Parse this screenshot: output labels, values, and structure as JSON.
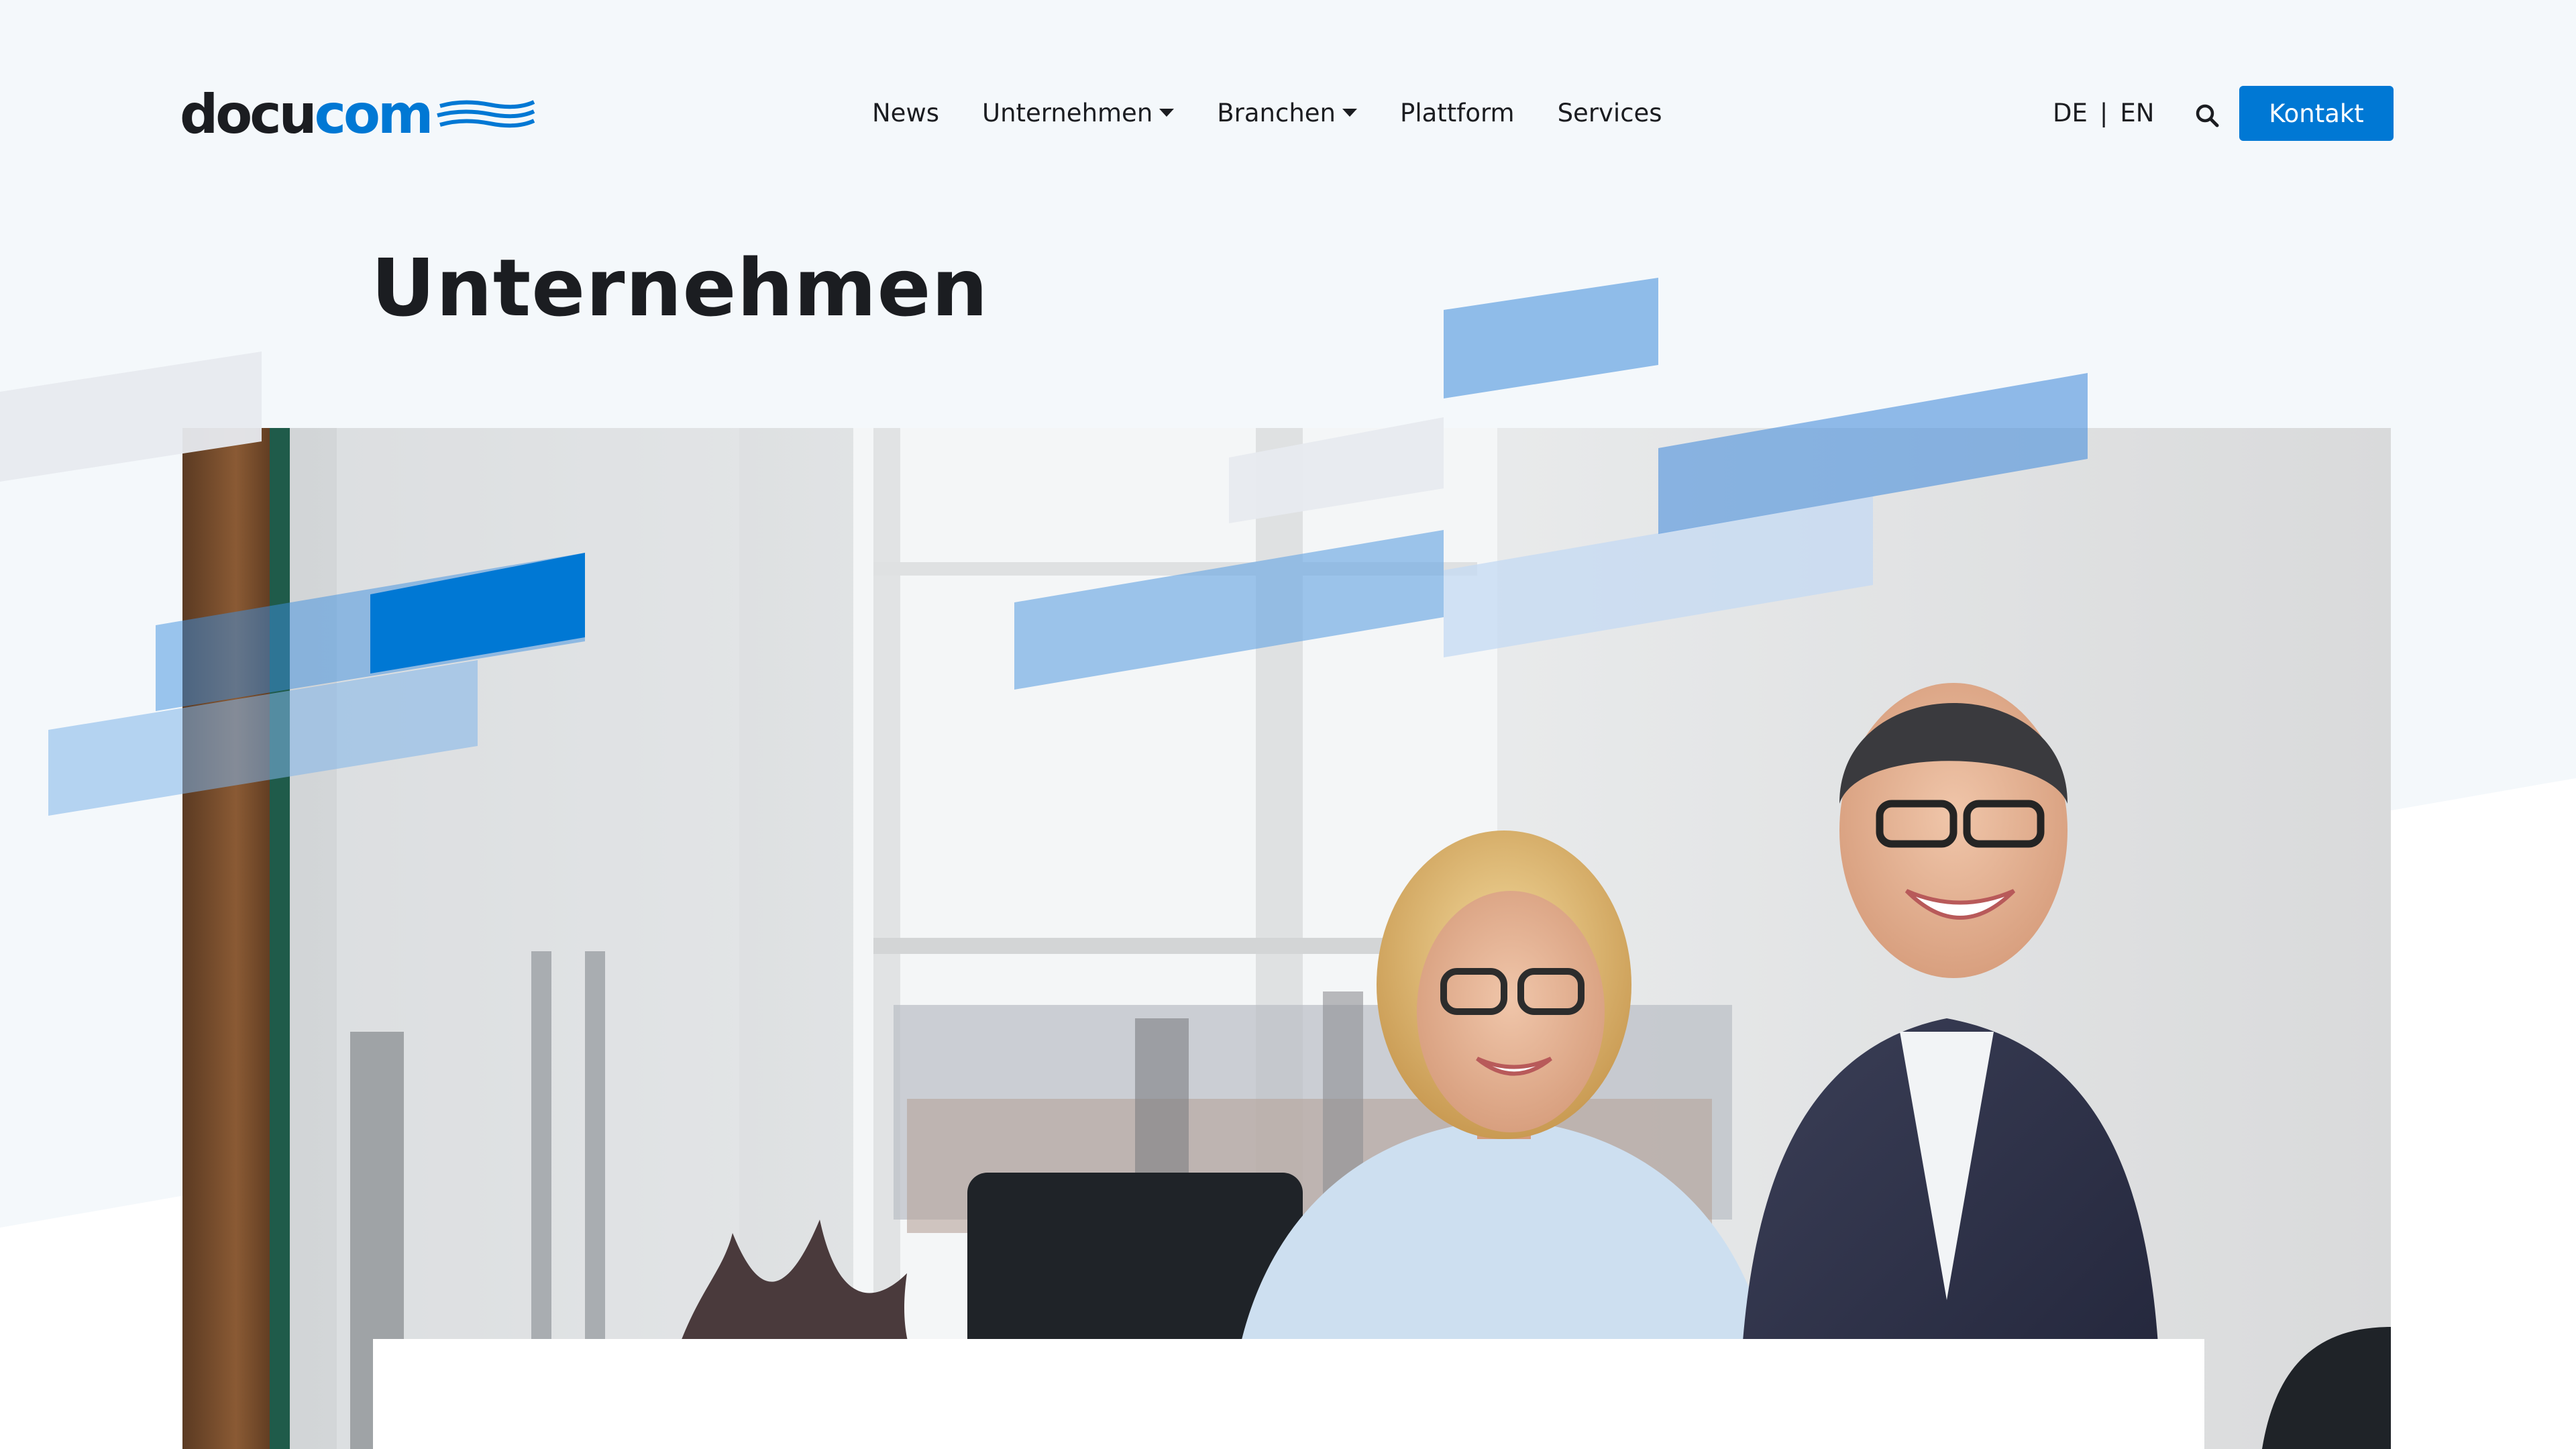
{
  "brand": {
    "logo_text_dark": "docu",
    "logo_text_blue": "com",
    "logo_icon": "wave-lines-icon",
    "accent_color": "#0078d4"
  },
  "nav": {
    "items": [
      {
        "label": "News",
        "has_dropdown": false
      },
      {
        "label": "Unternehmen",
        "has_dropdown": true
      },
      {
        "label": "Branchen",
        "has_dropdown": true
      },
      {
        "label": "Plattform",
        "has_dropdown": false
      },
      {
        "label": "Services",
        "has_dropdown": false
      }
    ],
    "lang_de": "DE",
    "lang_sep": "|",
    "lang_en": "EN",
    "search_icon": "search-icon",
    "contact_label": "Kontakt"
  },
  "page": {
    "title": "Unternehmen"
  },
  "hero": {
    "image": "two-smiling-people-office-photo"
  }
}
